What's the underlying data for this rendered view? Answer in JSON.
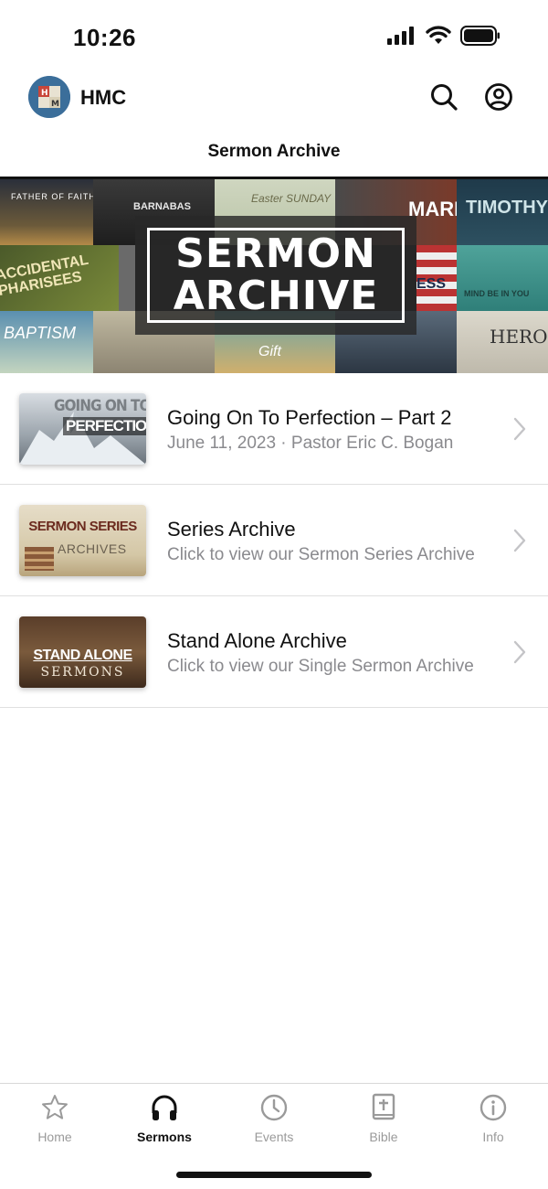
{
  "status": {
    "time": "10:26"
  },
  "header": {
    "app_name": "HMC",
    "avatar_letters": "H M"
  },
  "page": {
    "title": "Sermon Archive"
  },
  "banner": {
    "line1": "SERMON",
    "line2": "ARCHIVE",
    "tiles": [
      "FATHER OF FAITH",
      "BARNABAS",
      "Easter SUNDAY",
      "MARK",
      "TIMOTHY",
      "ACCIDENTAL PHARISEES",
      "BAPTISM",
      "Gift",
      "HERO",
      "MIND BE IN YOU",
      "ESS"
    ]
  },
  "list": [
    {
      "thumb_line1": "GOING ON TO",
      "thumb_line2": "PERFECTION",
      "title": "Going On To Perfection – Part 2",
      "subtitle": "June 11, 2023 · Pastor Eric C. Bogan"
    },
    {
      "thumb_line1": "SERMON SERIES",
      "thumb_line2": "ARCHIVES",
      "title": "Series Archive",
      "subtitle": "Click to view our Sermon Series Archive"
    },
    {
      "thumb_line1": "STAND ALONE",
      "thumb_line2": "SERMONS",
      "title": "Stand Alone Archive",
      "subtitle": "Click to view our Single Sermon Archive"
    }
  ],
  "tabs": [
    {
      "label": "Home",
      "icon": "star-icon"
    },
    {
      "label": "Sermons",
      "icon": "headphones-icon"
    },
    {
      "label": "Events",
      "icon": "clock-icon"
    },
    {
      "label": "Bible",
      "icon": "bible-icon"
    },
    {
      "label": "Info",
      "icon": "info-icon"
    }
  ],
  "colors": {
    "active_tab": "#111111",
    "inactive_tab": "#9a9a9a",
    "subtitle": "#8a8a8e"
  }
}
